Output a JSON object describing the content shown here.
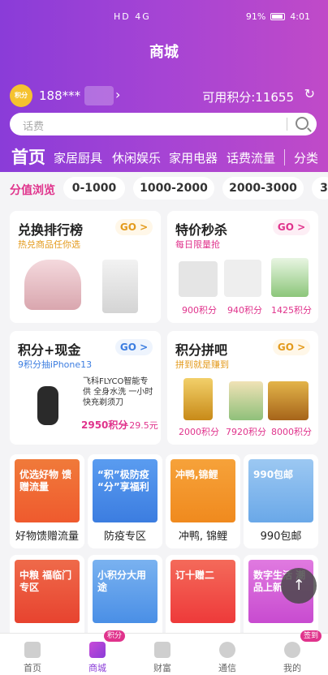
{
  "status": {
    "left": "HD 4G",
    "battery": "91%",
    "time": "4:01"
  },
  "title": "商城",
  "user": {
    "avatar_text": "积分",
    "name": "188***",
    "points": "可用积分:11655"
  },
  "search": {
    "placeholder": "话费"
  },
  "categories": [
    "首页",
    "家居厨具",
    "休闲娱乐",
    "家用电器",
    "话费流量",
    "分类"
  ],
  "filter": {
    "label": "分值浏览",
    "options": [
      "0-1000",
      "1000-2000",
      "2000-3000",
      "3"
    ]
  },
  "cards": {
    "exchange": {
      "title": "兑换排行榜",
      "sub": "热兑商品任你选",
      "go": "GO >"
    },
    "flash": {
      "title": "特价秒杀",
      "sub": "每日限量抢",
      "go": "GO >",
      "prices": [
        "900积分",
        "940积分",
        "1425积分"
      ]
    },
    "cash": {
      "title": "积分+现金",
      "sub": "9积分抽iPhone13",
      "go": "GO >",
      "product": "飞科FLYCO智能专供 全身水洗 一小时快充剃须刀",
      "price_points": "2950积分",
      "price_cash": "+29.5元"
    },
    "group": {
      "title": "积分拼吧",
      "sub": "拼到就是赚到",
      "go": "GO >",
      "prices": [
        "2000积分",
        "7920积分",
        "8000积分"
      ]
    }
  },
  "zones": [
    {
      "label": "好物馈赠流量",
      "img_text": "优选好物 馈赠流量",
      "color": "#ef5a2e"
    },
    {
      "label": "防疫专区",
      "img_text": "“积”极防疫 “分”享福利",
      "color": "#3c7de0"
    },
    {
      "label": "冲鸭, 锦鲤",
      "img_text": "冲鸭,锦鲤",
      "color": "#f08a1e"
    },
    {
      "label": "990包邮",
      "img_text": "990包邮",
      "color": "#6aa8e8"
    }
  ],
  "zones2": [
    {
      "img_text": "中粮 福临门专区",
      "color": "#e7432f"
    },
    {
      "img_text": "小积分大用途",
      "color": "#4a8fe6"
    },
    {
      "img_text": "订十赠二",
      "color": "#ee3a3a"
    },
    {
      "img_text": "数字生活 潮品上新",
      "color": "#c84bd0"
    }
  ],
  "tabs": [
    {
      "label": "首页",
      "badge": ""
    },
    {
      "label": "商城",
      "badge": "积分"
    },
    {
      "label": "财富",
      "badge": ""
    },
    {
      "label": "通信",
      "badge": ""
    },
    {
      "label": "我的",
      "badge": "签到"
    }
  ]
}
